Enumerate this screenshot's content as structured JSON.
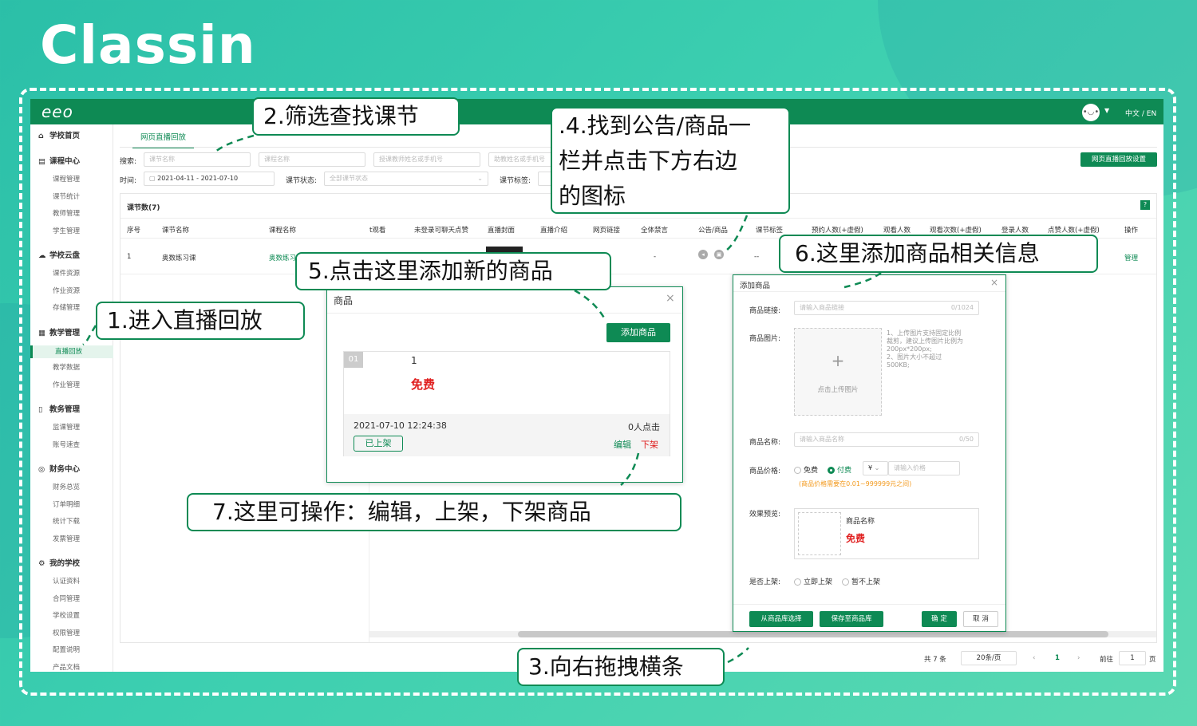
{
  "logo": "Classin",
  "app": {
    "brand": "eeo",
    "avatar": "•◡•",
    "lang": "中文 / EN"
  },
  "sidebar": {
    "groups": [
      {
        "label": "学校首页",
        "icon": "⌂",
        "items": []
      },
      {
        "label": "课程中心",
        "icon": "▤",
        "items": [
          "课程管理",
          "课节统计",
          "教师管理",
          "学生管理"
        ]
      },
      {
        "label": "学校云盘",
        "icon": "☁",
        "items": [
          "课件资源",
          "作业资源",
          "存储管理"
        ]
      },
      {
        "label": "教学管理",
        "icon": "▦",
        "items": [
          "直播回放",
          "教学数据",
          "作业管理"
        ]
      },
      {
        "label": "教务管理",
        "icon": "▯",
        "items": [
          "监课管理",
          "账号速查"
        ]
      },
      {
        "label": "财务中心",
        "icon": "◎",
        "items": [
          "财务总览",
          "订单明细",
          "统计下载",
          "发票管理"
        ]
      },
      {
        "label": "我的学校",
        "icon": "⚙",
        "items": [
          "认证资料",
          "合同管理",
          "学校设置",
          "权限管理",
          "配置说明",
          "产品文档"
        ]
      }
    ]
  },
  "main": {
    "tab": "网页直播回放",
    "filters": {
      "search_label": "搜索:",
      "lesson_name_ph": "课节名称",
      "course_name_ph": "课程名称",
      "teacher_ph": "授课教师姓名或手机号",
      "assistant_ph": "助教姓名或手机号",
      "time_label": "时间:",
      "date_range": "2021-04-11  - 2021-07-10",
      "status_label": "课节状态:",
      "status_value": "全部课节状态",
      "tag_label": "课节标签:"
    },
    "settings_button": "网页直播回放设置",
    "panel_title": "课节数(7)",
    "help": "?",
    "columns": [
      "序号",
      "课节名称",
      "课程名称",
      "t观看",
      "未登录可聊天点赞",
      "直播封面",
      "直播介绍",
      "网页链接",
      "全体禁言",
      "公告/商品",
      "课节标签",
      "预约人数(+虚假)",
      "观看人数",
      "观看次数(+虚假)",
      "登录人数",
      "点赞人数(+虚假)",
      "操作"
    ],
    "row": {
      "index": "1",
      "lesson": "奥数练习课",
      "course": "奥数练习",
      "mute": "-",
      "tag": "--",
      "action": "管理"
    },
    "pager": {
      "total": "共 7 条",
      "size": "20条/页",
      "prev": "‹",
      "page": "1",
      "next": "›",
      "goto": "前往",
      "goto_value": "1",
      "unit": "页"
    }
  },
  "goods_modal": {
    "title": "商品",
    "close": "×",
    "add_button": "添加商品",
    "item": {
      "index": "01",
      "name": "1",
      "price": "免费",
      "time": "2021-07-10 12:24:38",
      "clicks": "0人点击",
      "status": "已上架",
      "edit": "编辑",
      "off": "下架"
    }
  },
  "add_modal": {
    "title": "添加商品",
    "close": "×",
    "link_label": "商品链接:",
    "link_ph": "请输入商品链接",
    "link_count": "0/1024",
    "image_label": "商品图片:",
    "upload_plus": "+",
    "upload_text": "点击上传图片",
    "upload_tips": "1、上传图片支持固定比例\n裁剪，建议上传图片比例为\n200px*200px;\n2、图片大小不超过\n500KB;",
    "name_label": "商品名称:",
    "name_ph": "请输入商品名称",
    "name_count": "0/50",
    "price_label": "商品价格:",
    "free": "免费",
    "paid": "付费",
    "currency": "¥",
    "price_ph": "请输入价格",
    "price_hint": "(商品价格需要在0.01~999999元之间)",
    "preview_label": "效果预览:",
    "preview_name": "商品名称",
    "preview_price": "免费",
    "shelf_label": "是否上架:",
    "shelf_now": "立即上架",
    "shelf_later": "暂不上架",
    "btn_library": "从商品库选择",
    "btn_save_lib": "保存至商品库",
    "btn_ok": "确 定",
    "btn_cancel": "取 消"
  },
  "callouts": {
    "c1": "1.进入直播回放",
    "c2": "2.筛选查找课节",
    "c3": "3.向右拖拽横条",
    "c4_l1": ".4.找到公告/商品一",
    "c4_l2": "栏并点击下方右边",
    "c4_l3": "的图标",
    "c5": "5.点击这里添加新的商品",
    "c6": "6.这里添加商品相关信息",
    "c7": "7.这里可操作：编辑，上架，下架商品"
  },
  "colors": {
    "brand_green": "#0e8a54",
    "price_red": "#e02020",
    "background": "#3ccfb0"
  }
}
